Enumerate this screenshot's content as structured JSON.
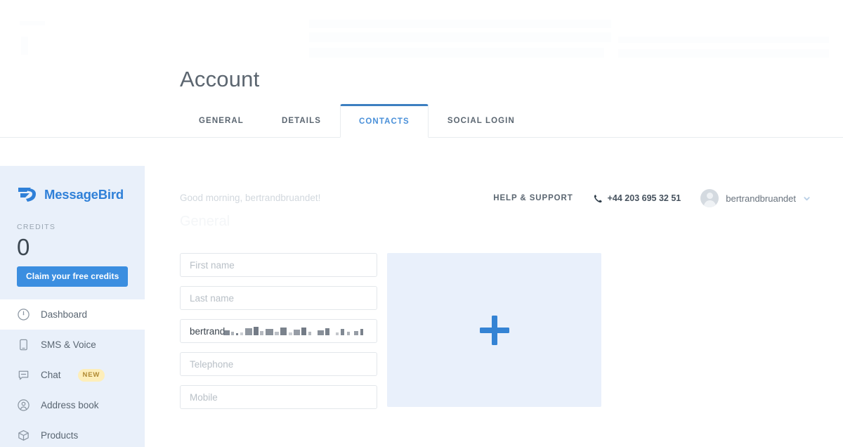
{
  "page": {
    "title": "Account"
  },
  "tabs": [
    {
      "label": "GENERAL",
      "active": false
    },
    {
      "label": "DETAILS",
      "active": false
    },
    {
      "label": "CONTACTS",
      "active": true
    },
    {
      "label": "SOCIAL LOGIN",
      "active": false
    }
  ],
  "sidebar": {
    "brand": "MessageBird",
    "brand_icon": "messagebird-logo-icon",
    "credits_label": "CREDITS",
    "credits_value": "0",
    "claim_button": "Claim your free credits",
    "items": [
      {
        "label": "Dashboard",
        "icon": "gauge-icon",
        "active": true,
        "badge": ""
      },
      {
        "label": "SMS & Voice",
        "icon": "mobile-phone-icon",
        "active": false,
        "badge": ""
      },
      {
        "label": "Chat",
        "icon": "chat-bubble-icon",
        "active": false,
        "badge": "NEW"
      },
      {
        "label": "Address book",
        "icon": "user-circle-icon",
        "active": false,
        "badge": ""
      },
      {
        "label": "Products",
        "icon": "cube-icon",
        "active": false,
        "badge": ""
      }
    ]
  },
  "utility": {
    "greeting": "Good morning, bertrandbruandet!",
    "section_heading": "General",
    "help_label": "HELP & SUPPORT",
    "phone_icon": "phone-handset-icon",
    "phone_number": "+44 203 695 32 51",
    "avatar_icon": "user-avatar-icon",
    "user_name": "bertrandbruandet",
    "chevron_icon": "chevron-down-icon"
  },
  "form": {
    "first_name": {
      "placeholder": "First name",
      "value": ""
    },
    "last_name": {
      "placeholder": "Last name",
      "value": ""
    },
    "email": {
      "visible_text": "bertrand",
      "redacted": true
    },
    "telephone": {
      "placeholder": "Telephone",
      "value": ""
    },
    "mobile": {
      "placeholder": "Mobile",
      "value": ""
    },
    "add_panel": {
      "icon": "plus-icon",
      "label": ""
    }
  },
  "colors": {
    "brand_blue": "#2f80d8",
    "accent_blue": "#3b8ee0",
    "active_tab": "#4a90d9",
    "tab_underline": "#3d7fc1",
    "sidebar_bg": "#e9f0fa",
    "panel_bg": "#e9f0fb",
    "badge_bg": "#fdeeba",
    "badge_text": "#b08a34"
  }
}
